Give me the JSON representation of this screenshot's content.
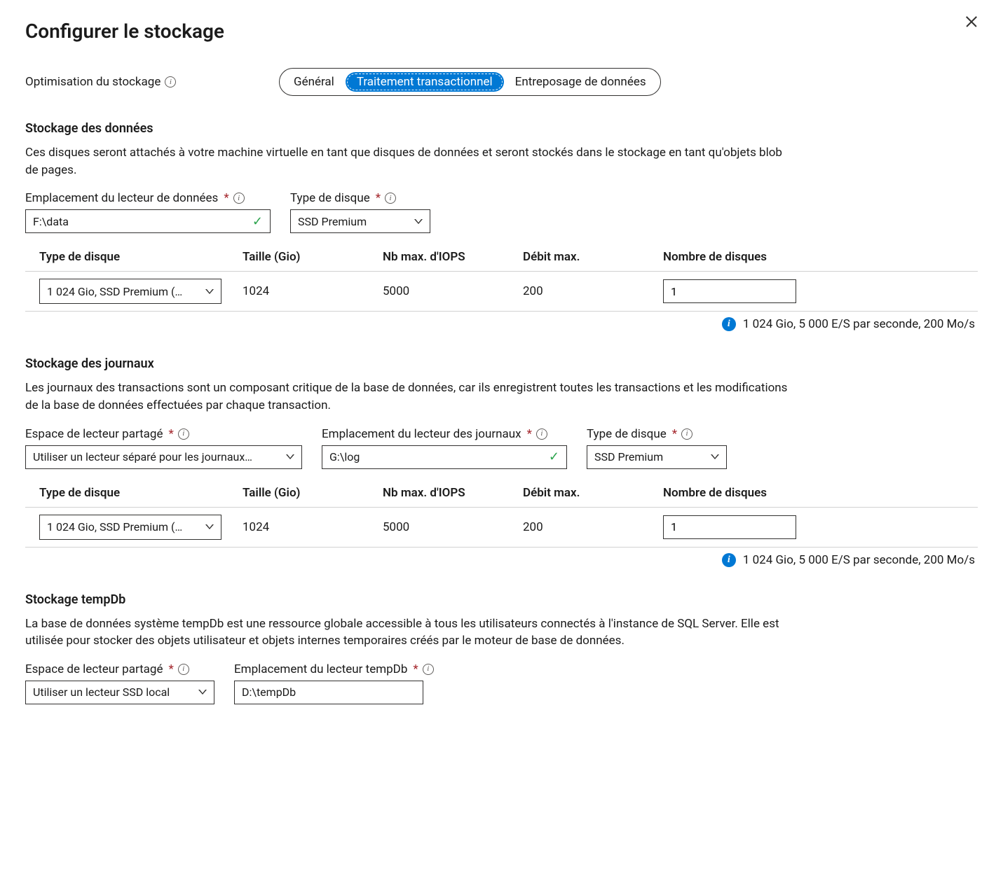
{
  "page": {
    "title": "Configurer le stockage"
  },
  "opt": {
    "label": "Optimisation du stockage",
    "general": "Général",
    "transactional": "Traitement transactionnel",
    "warehouse": "Entreposage de données"
  },
  "data_section": {
    "title": "Stockage des données",
    "desc": "Ces disques seront attachés à votre machine virtuelle en tant que disques de données et seront stockés dans le stockage en tant qu'objets blob de pages.",
    "drive_label": "Emplacement du lecteur de données",
    "drive_value": "F:\\data",
    "disktype_label": "Type de disque",
    "disktype_value": "SSD Premium",
    "table": {
      "col_disktype": "Type de disque",
      "col_size": "Taille (Gio)",
      "col_iops": "Nb max. d'IOPS",
      "col_throughput": "Débit max.",
      "col_count": "Nombre de disques",
      "row_disktype": "1 024 Gio, SSD Premium (…",
      "row_size": "1024",
      "row_iops": "5000",
      "row_throughput": "200",
      "row_count": "1",
      "summary": "1 024 Gio, 5 000 E/S par seconde, 200 Mo/s"
    }
  },
  "log_section": {
    "title": "Stockage des journaux",
    "desc": "Les journaux des transactions sont un composant critique de la base de données, car ils enregistrent toutes les transactions et les modifications de la base de données effectuées par chaque transaction.",
    "shared_label": "Espace de lecteur partagé",
    "shared_value": "Utiliser un lecteur séparé pour les journaux…",
    "drive_label": "Emplacement du lecteur des journaux",
    "drive_value": "G:\\log",
    "disktype_label": "Type de disque",
    "disktype_value": "SSD Premium",
    "table": {
      "col_disktype": "Type de disque",
      "col_size": "Taille (Gio)",
      "col_iops": "Nb max. d'IOPS",
      "col_throughput": "Débit max.",
      "col_count": "Nombre de disques",
      "row_disktype": "1 024 Gio, SSD Premium (…",
      "row_size": "1024",
      "row_iops": "5000",
      "row_throughput": "200",
      "row_count": "1",
      "summary": "1 024 Gio, 5 000 E/S par seconde, 200 Mo/s"
    }
  },
  "temp_section": {
    "title": "Stockage tempDb",
    "desc": "La base de données système tempDb est une ressource globale accessible à tous les utilisateurs connectés à l'instance de SQL Server. Elle est utilisée pour stocker des objets utilisateur et objets internes temporaires créés par le moteur de base de données.",
    "shared_label": "Espace de lecteur partagé",
    "shared_value": "Utiliser un lecteur SSD local",
    "drive_label": "Emplacement du lecteur tempDb",
    "drive_value": "D:\\tempDb"
  }
}
